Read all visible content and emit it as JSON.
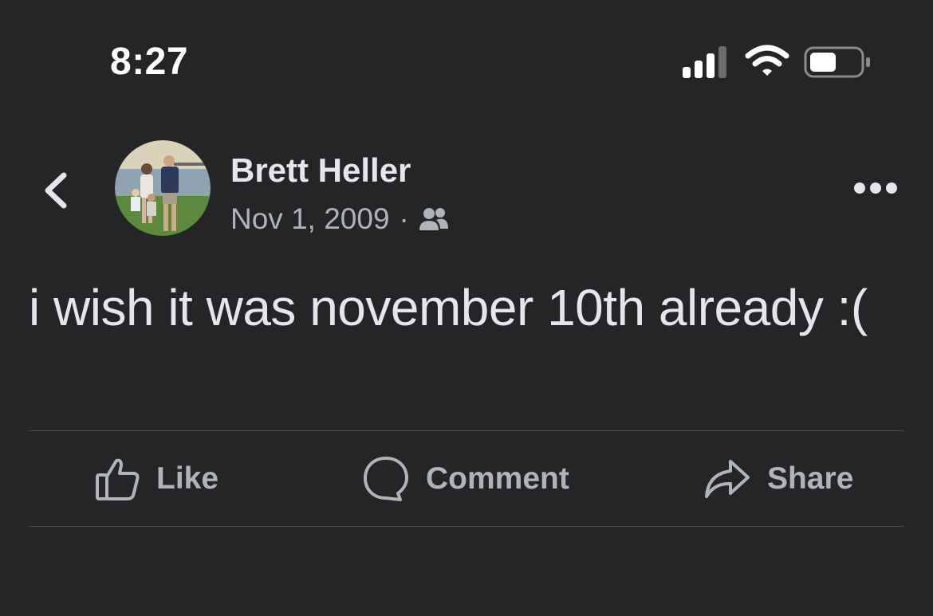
{
  "status_bar": {
    "time": "8:27",
    "signal_icon": "cellular-signal-icon",
    "wifi_icon": "wifi-icon",
    "battery_icon": "battery-icon",
    "battery_level": 0.5
  },
  "post": {
    "back_icon": "chevron-left-icon",
    "author": "Brett Heller",
    "date": "Nov 1, 2009",
    "separator": "·",
    "audience_icon": "friends-icon",
    "more_icon": "more-dots-icon",
    "text": "i wish it was november 10th already :("
  },
  "actions": {
    "like_label": "Like",
    "like_icon": "thumbs-up-icon",
    "comment_label": "Comment",
    "comment_icon": "comment-bubble-icon",
    "share_label": "Share",
    "share_icon": "share-arrow-icon"
  },
  "colors": {
    "background": "#242526",
    "primary_text": "#e4e6eb",
    "secondary_text": "#b0b3b8",
    "divider": "#4a4b4d"
  }
}
